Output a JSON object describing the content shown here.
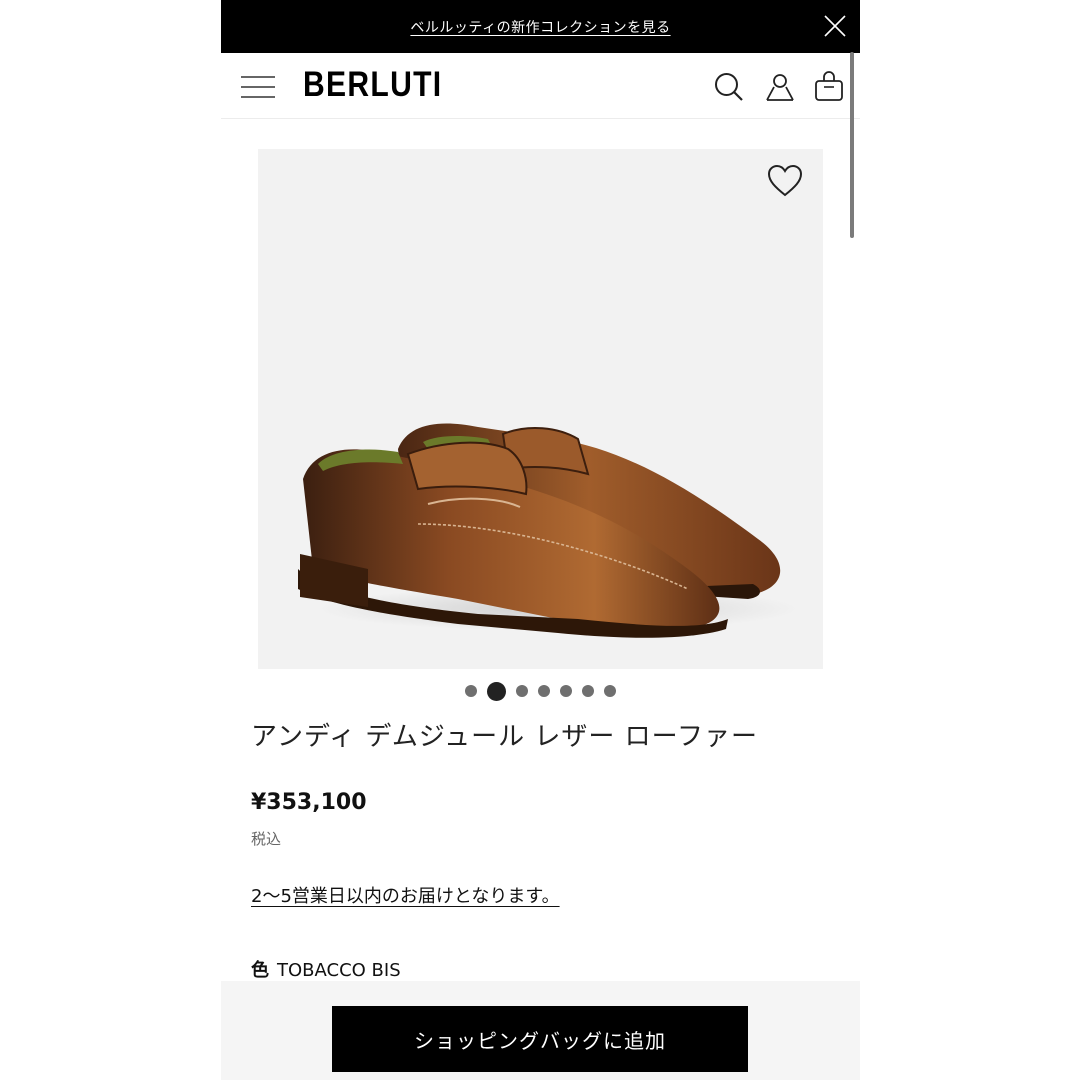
{
  "promo": {
    "text": "ベルルッティの新作コレクションを見る"
  },
  "header": {
    "logo": "BERLUTI"
  },
  "product": {
    "title": "アンディ デムジュール レザー ローファー",
    "price": "¥353,100",
    "tax_note": "税込",
    "delivery": "2〜5営業日以内のお届けとなります。",
    "color_label": "色",
    "color_value": "TOBACCO BIS"
  },
  "gallery": {
    "active_index": 1,
    "count": 7
  },
  "actions": {
    "add_to_bag": "ショッピングバッグに追加"
  },
  "icons": [
    "close-icon",
    "menu-icon",
    "search-icon",
    "account-icon",
    "bag-icon",
    "heart-icon"
  ],
  "colors": {
    "bar": "#000000",
    "image_bg": "#f2f2f2",
    "leather": "#8a4a22"
  }
}
